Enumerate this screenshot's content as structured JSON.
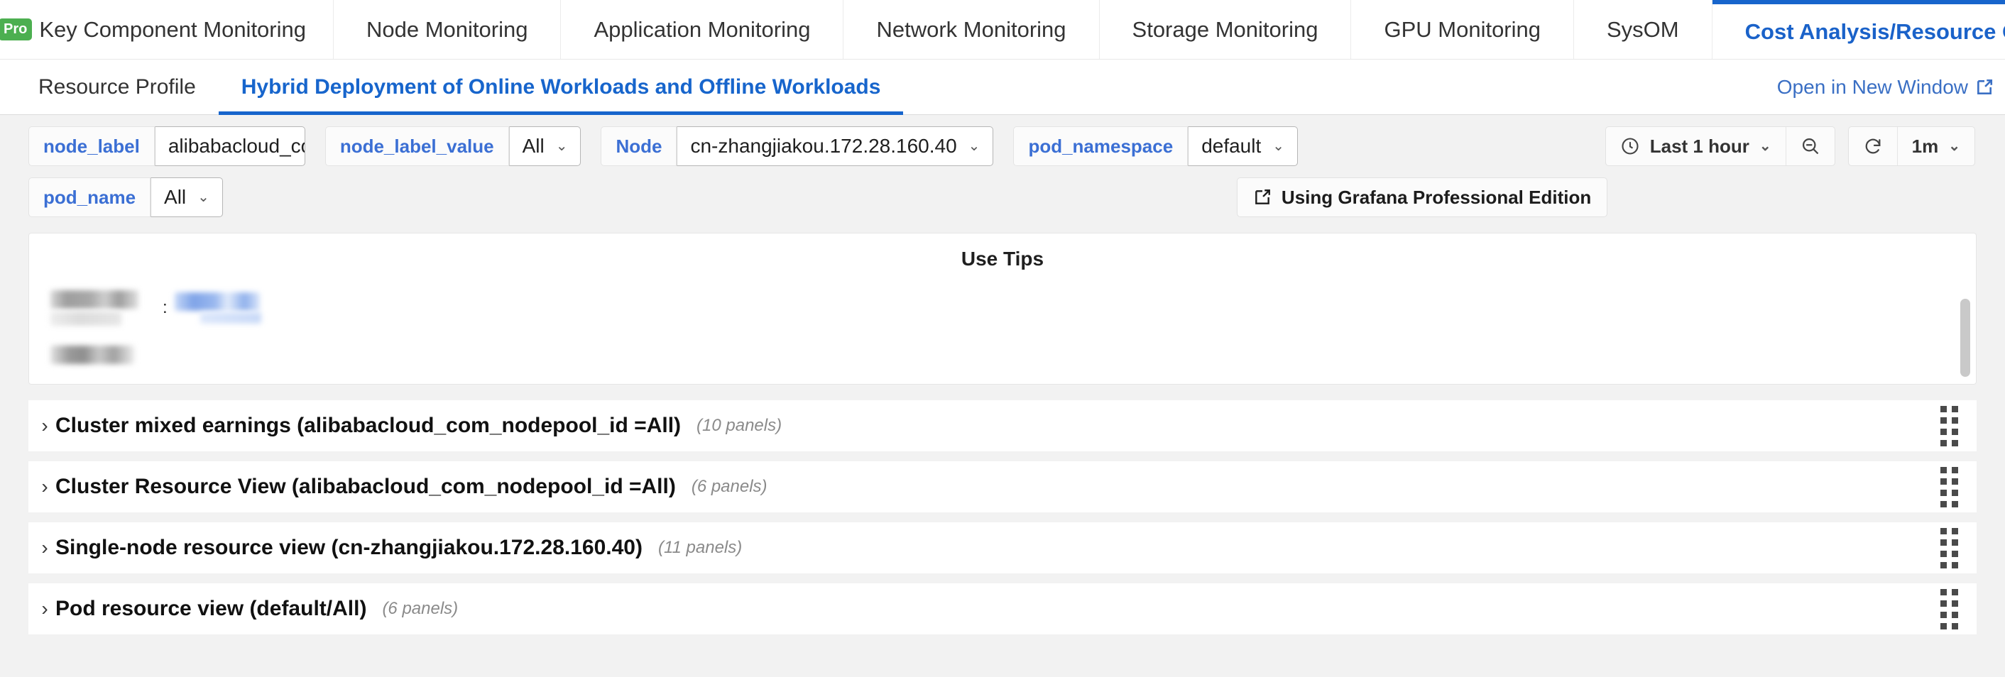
{
  "top_tabs": [
    {
      "label": "Key Component Monitoring",
      "badge": "Pro",
      "active": false
    },
    {
      "label": "Node Monitoring",
      "badge": "",
      "active": false
    },
    {
      "label": "Application Monitoring",
      "badge": "",
      "active": false
    },
    {
      "label": "Network Monitoring",
      "badge": "",
      "active": false
    },
    {
      "label": "Storage Monitoring",
      "badge": "",
      "active": false
    },
    {
      "label": "GPU Monitoring",
      "badge": "",
      "active": false
    },
    {
      "label": "SysOM",
      "badge": "",
      "active": false
    },
    {
      "label": "Cost Analysis/Resource Optimization",
      "badge": "",
      "active": true
    }
  ],
  "tab_nav": {
    "prev": "‹",
    "next": "›"
  },
  "sub_tabs": [
    {
      "label": "Resource Profile",
      "active": false
    },
    {
      "label": "Hybrid Deployment of Online Workloads and Offline Workloads",
      "active": true
    }
  ],
  "open_new_window": {
    "label": "Open in New Window",
    "icon": "external-link-icon"
  },
  "variables": [
    {
      "name": "node_label",
      "value": "alibabacloud_com_node",
      "type": "textbox"
    },
    {
      "name": "node_label_value",
      "value": "All",
      "type": "select"
    },
    {
      "name": "Node",
      "value": "cn-zhangjiakou.172.28.160.40",
      "type": "select"
    },
    {
      "name": "pod_namespace",
      "value": "default",
      "type": "select"
    },
    {
      "name": "pod_name",
      "value": "All",
      "type": "select"
    }
  ],
  "grafana_button": {
    "label": "Using Grafana Professional Edition",
    "icon": "external-link-icon"
  },
  "time_controls": {
    "clock_icon": "clock-icon",
    "range_label": "Last 1 hour",
    "zoom_out_icon": "zoom-out-icon",
    "refresh_icon": "refresh-icon",
    "refresh_interval": "1m"
  },
  "tips_panel": {
    "title": "Use Tips",
    "redacted": true,
    "lines": [
      {
        "colon": ":"
      },
      {
        "colon": ""
      }
    ]
  },
  "row_sections": [
    {
      "caret": "›",
      "title": "Cluster mixed earnings (alibabacloud_com_nodepool_id =All)",
      "count": "(10 panels)"
    },
    {
      "caret": "›",
      "title": "Cluster Resource View (alibabacloud_com_nodepool_id =All)",
      "count": "(6 panels)"
    },
    {
      "caret": "›",
      "title": "Single-node resource view (cn-zhangjiakou.172.28.160.40)",
      "count": "(11 panels)"
    },
    {
      "caret": "›",
      "title": "Pod resource view (default/All)",
      "count": "(6 panels)"
    }
  ],
  "colors": {
    "accent_blue": "#1765cc",
    "link_blue": "#3b6fd4",
    "pro_green": "#4caf50",
    "page_bg": "#f2f2f2"
  }
}
